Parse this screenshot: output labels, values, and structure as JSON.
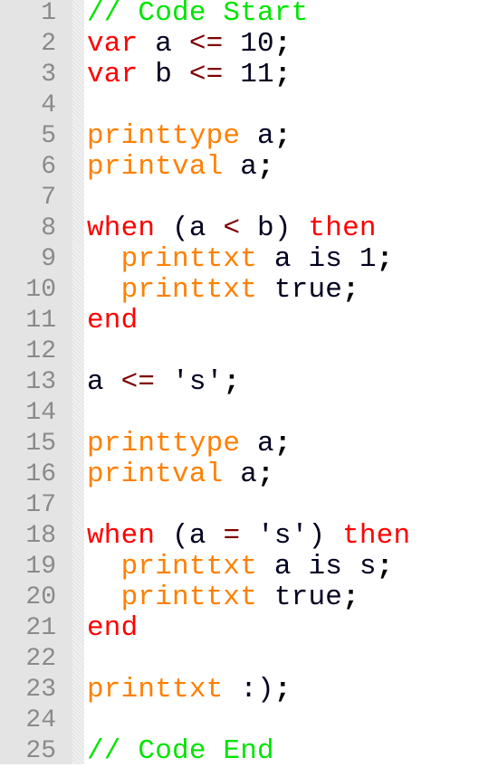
{
  "editor": {
    "colors": {
      "comment": "#00e400",
      "keyword": "#ff0000",
      "builtin": "#ff8000",
      "op": "#800000",
      "ident": "#000020",
      "gutter": "#e4e4e4",
      "line_number": "#8a8a8a"
    },
    "lines": [
      {
        "n": "1",
        "tokens": [
          {
            "t": "// Code Start",
            "c": "comment"
          }
        ]
      },
      {
        "n": "2",
        "tokens": [
          {
            "t": "var",
            "c": "keyword"
          },
          {
            "t": " a ",
            "c": "ident"
          },
          {
            "t": "<=",
            "c": "op"
          },
          {
            "t": " 10",
            "c": "ident"
          },
          {
            "t": ";",
            "c": "punct"
          }
        ]
      },
      {
        "n": "3",
        "tokens": [
          {
            "t": "var",
            "c": "keyword"
          },
          {
            "t": " b ",
            "c": "ident"
          },
          {
            "t": "<=",
            "c": "op"
          },
          {
            "t": " 11",
            "c": "ident"
          },
          {
            "t": ";",
            "c": "punct"
          }
        ]
      },
      {
        "n": "4",
        "tokens": []
      },
      {
        "n": "5",
        "tokens": [
          {
            "t": "printtype",
            "c": "builtin"
          },
          {
            "t": " a",
            "c": "ident"
          },
          {
            "t": ";",
            "c": "punct"
          }
        ]
      },
      {
        "n": "6",
        "tokens": [
          {
            "t": "printval",
            "c": "builtin"
          },
          {
            "t": " a",
            "c": "ident"
          },
          {
            "t": ";",
            "c": "punct"
          }
        ]
      },
      {
        "n": "7",
        "tokens": []
      },
      {
        "n": "8",
        "tokens": [
          {
            "t": "when",
            "c": "keyword"
          },
          {
            "t": " (a ",
            "c": "ident"
          },
          {
            "t": "<",
            "c": "op"
          },
          {
            "t": " b) ",
            "c": "ident"
          },
          {
            "t": "then",
            "c": "keyword"
          }
        ]
      },
      {
        "n": "9",
        "tokens": [
          {
            "t": "  ",
            "c": "ident"
          },
          {
            "t": "printtxt",
            "c": "builtin"
          },
          {
            "t": " a is 1",
            "c": "ident"
          },
          {
            "t": ";",
            "c": "punct"
          }
        ]
      },
      {
        "n": "10",
        "tokens": [
          {
            "t": "  ",
            "c": "ident"
          },
          {
            "t": "printtxt",
            "c": "builtin"
          },
          {
            "t": " true",
            "c": "ident"
          },
          {
            "t": ";",
            "c": "punct"
          }
        ]
      },
      {
        "n": "11",
        "tokens": [
          {
            "t": "end",
            "c": "keyword"
          }
        ]
      },
      {
        "n": "12",
        "tokens": []
      },
      {
        "n": "13",
        "tokens": [
          {
            "t": "a ",
            "c": "ident"
          },
          {
            "t": "<=",
            "c": "op"
          },
          {
            "t": " 's'",
            "c": "ident"
          },
          {
            "t": ";",
            "c": "punct"
          }
        ]
      },
      {
        "n": "14",
        "tokens": []
      },
      {
        "n": "15",
        "tokens": [
          {
            "t": "printtype",
            "c": "builtin"
          },
          {
            "t": " a",
            "c": "ident"
          },
          {
            "t": ";",
            "c": "punct"
          }
        ]
      },
      {
        "n": "16",
        "tokens": [
          {
            "t": "printval",
            "c": "builtin"
          },
          {
            "t": " a",
            "c": "ident"
          },
          {
            "t": ";",
            "c": "punct"
          }
        ]
      },
      {
        "n": "17",
        "tokens": []
      },
      {
        "n": "18",
        "tokens": [
          {
            "t": "when",
            "c": "keyword"
          },
          {
            "t": " (a ",
            "c": "ident"
          },
          {
            "t": "=",
            "c": "op"
          },
          {
            "t": " 's') ",
            "c": "ident"
          },
          {
            "t": "then",
            "c": "keyword"
          }
        ]
      },
      {
        "n": "19",
        "tokens": [
          {
            "t": "  ",
            "c": "ident"
          },
          {
            "t": "printtxt",
            "c": "builtin"
          },
          {
            "t": " a is s",
            "c": "ident"
          },
          {
            "t": ";",
            "c": "punct"
          }
        ]
      },
      {
        "n": "20",
        "tokens": [
          {
            "t": "  ",
            "c": "ident"
          },
          {
            "t": "printtxt",
            "c": "builtin"
          },
          {
            "t": " true",
            "c": "ident"
          },
          {
            "t": ";",
            "c": "punct"
          }
        ]
      },
      {
        "n": "21",
        "tokens": [
          {
            "t": "end",
            "c": "keyword"
          }
        ]
      },
      {
        "n": "22",
        "tokens": []
      },
      {
        "n": "23",
        "tokens": [
          {
            "t": "printtxt",
            "c": "builtin"
          },
          {
            "t": " :)",
            "c": "ident"
          },
          {
            "t": ";",
            "c": "punct"
          }
        ]
      },
      {
        "n": "24",
        "tokens": []
      },
      {
        "n": "25",
        "tokens": [
          {
            "t": "// Code End",
            "c": "comment"
          }
        ]
      }
    ]
  }
}
